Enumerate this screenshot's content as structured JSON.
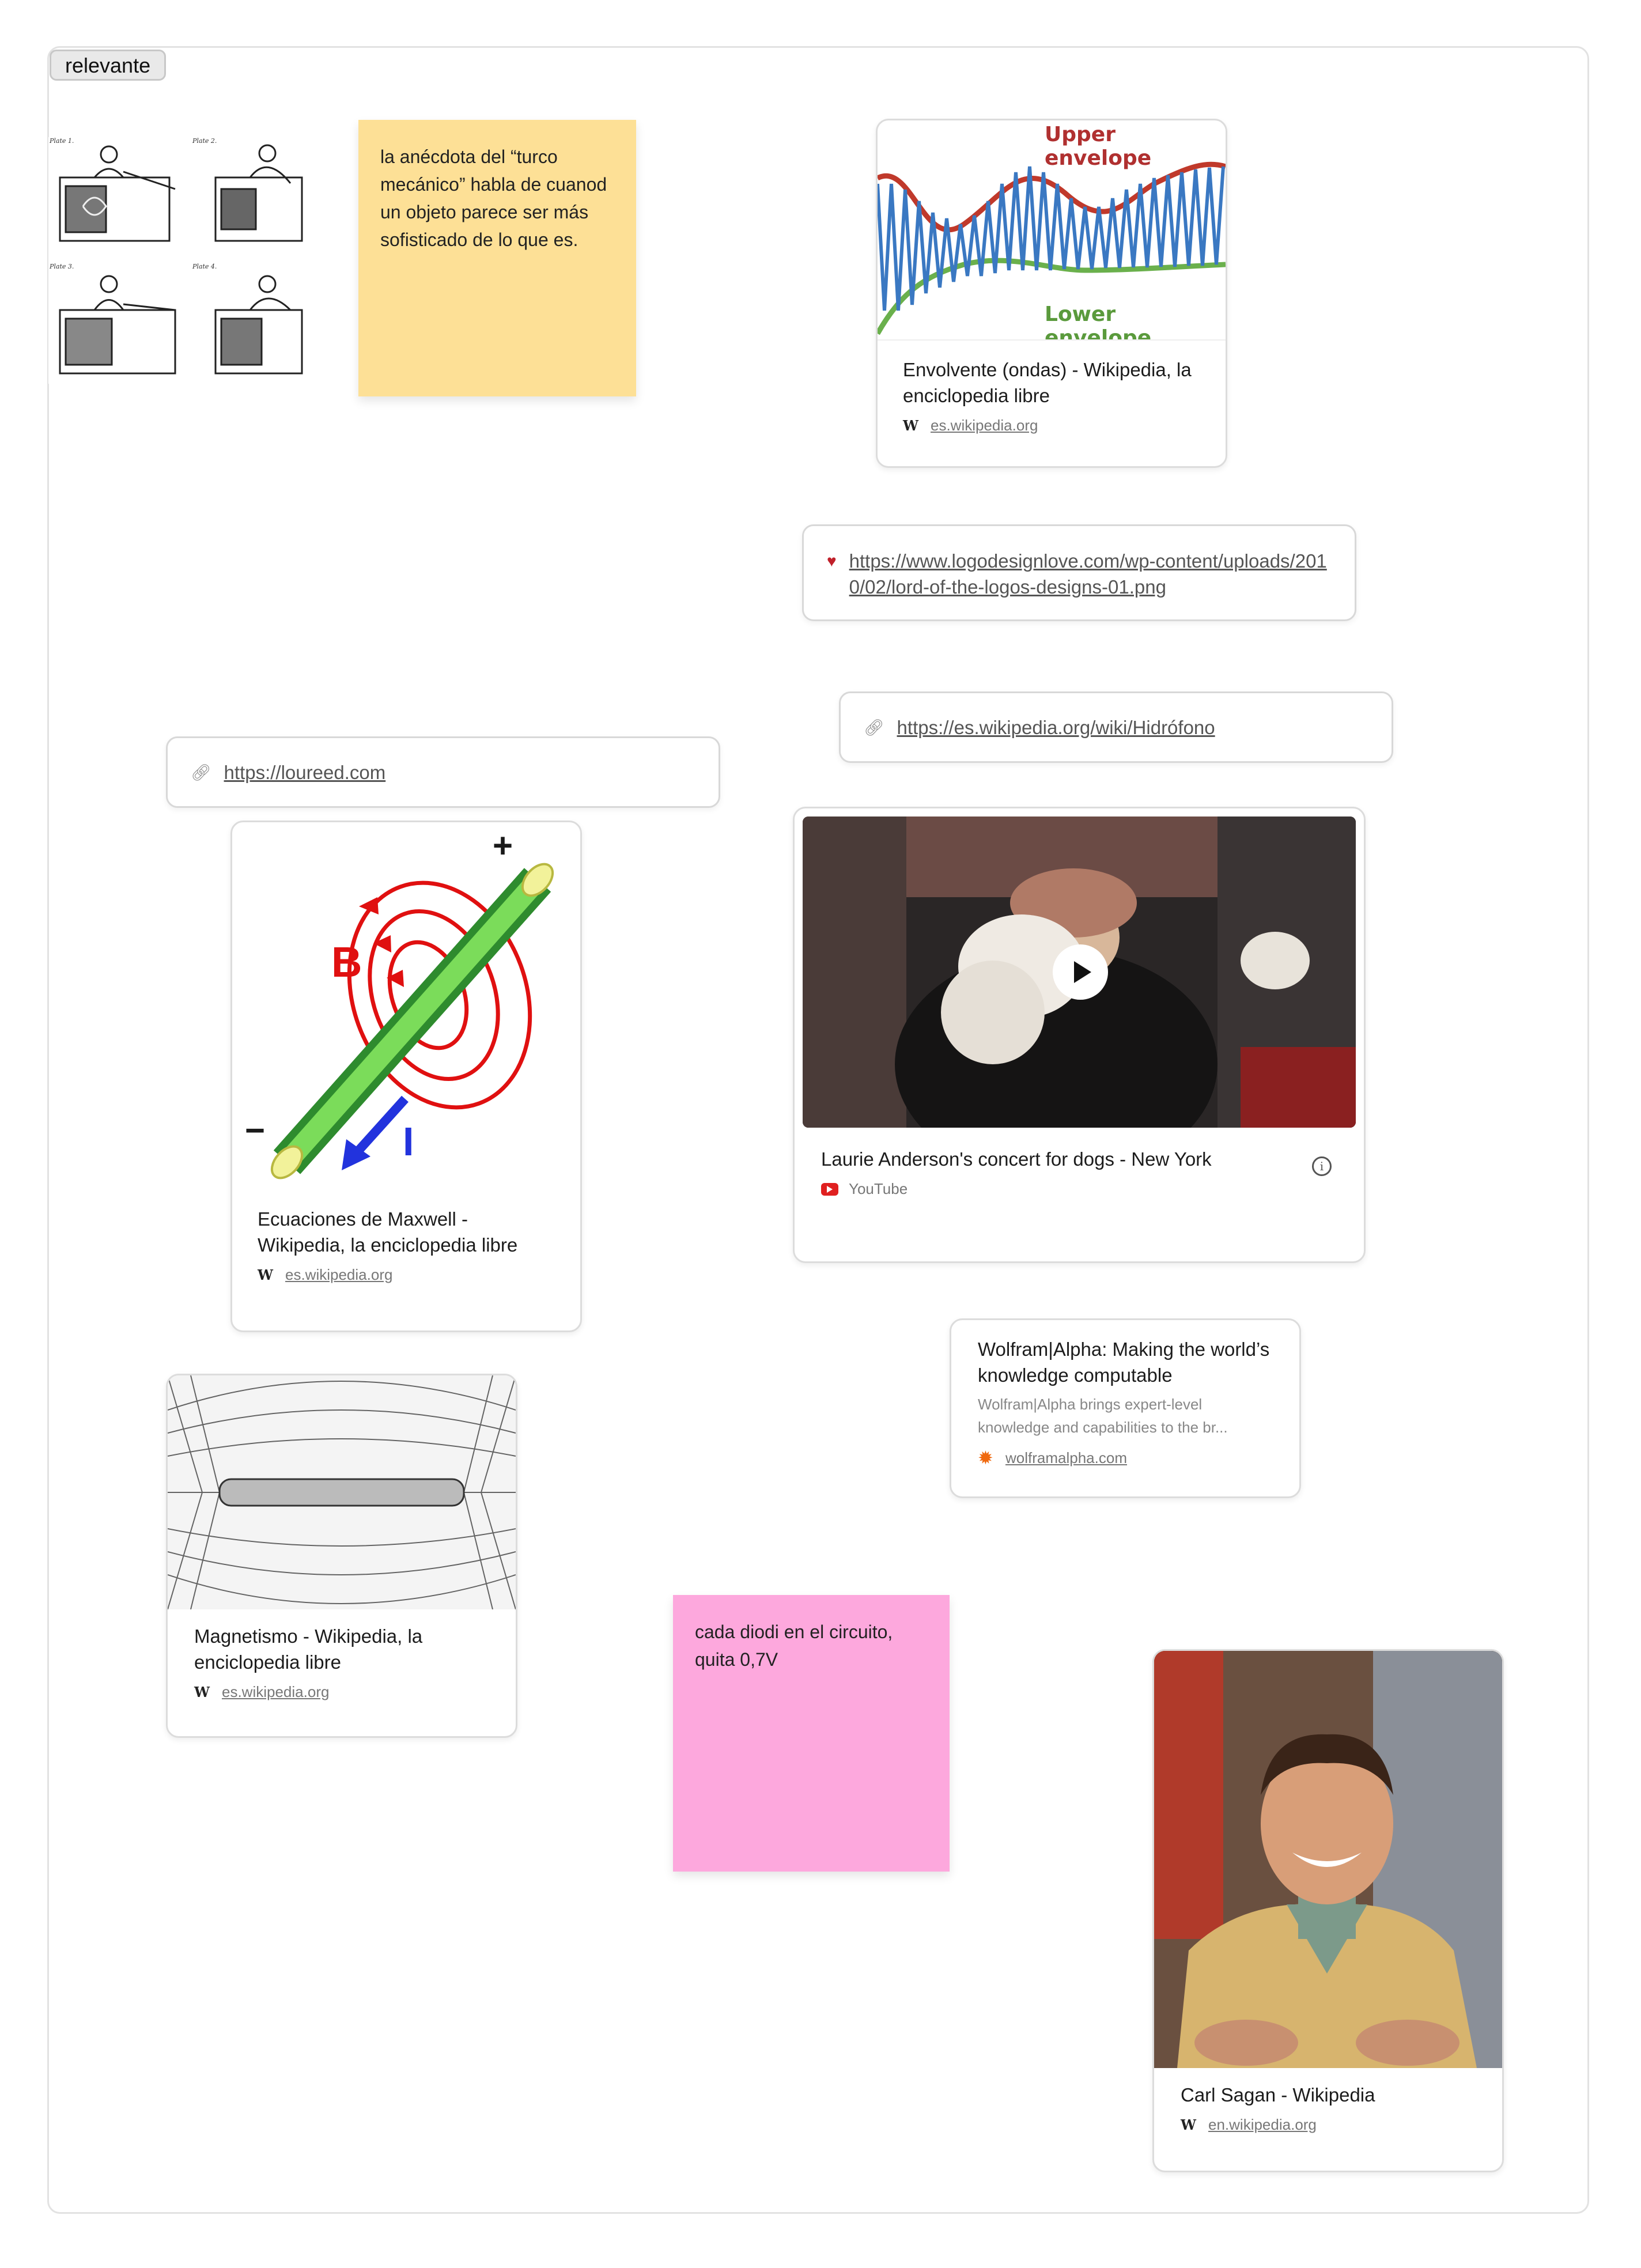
{
  "frame": {
    "label": "relevante"
  },
  "notes": {
    "turco": {
      "text": "la anécdota del “turco mecánico” habla de cuanod un objeto parece ser más sofisticado de lo que es.",
      "color": "#fde096"
    },
    "diodo": {
      "text": "cada diodi en el circuito, quita 0,7V",
      "color": "#fda8dd"
    }
  },
  "cards": {
    "envolvente": {
      "title": "Envolvente (ondas) - Wikipedia, la enciclopedia libre",
      "source": "es.wikipedia.org",
      "image_labels": {
        "upper": "Upper envelope",
        "lower": "Lower envelope"
      }
    },
    "maxwell": {
      "title": "Ecuaciones de Maxwell - Wikipedia, la enciclopedia libre",
      "source": "es.wikipedia.org",
      "image_labels": {
        "plus": "+",
        "minus": "−",
        "b": "B",
        "i": "I"
      }
    },
    "video": {
      "title": "Laurie Anderson's concert for dogs - New York",
      "source": "YouTube"
    },
    "wolfram": {
      "title": "Wolfram|Alpha: Making the world’s knowledge computable",
      "description": "Wolfram|Alpha brings expert-level knowledge and capabilities to the br...",
      "source": "wolframalpha.com"
    },
    "magnetismo": {
      "title": "Magnetismo - Wikipedia, la enciclopedia libre",
      "source": "es.wikipedia.org"
    },
    "sagan": {
      "title": "Carl Sagan - Wikipedia",
      "source": "en.wikipedia.org"
    }
  },
  "links": {
    "logodesign": {
      "url": "https://www.logodesignlove.com/wp-content/uploads/2010/02/lord-of-the-logos-designs-01.png"
    },
    "hidrofono": {
      "url": "https://es.wikipedia.org/wiki/Hidrófono"
    },
    "loureed": {
      "url": "https://loureed.com"
    }
  },
  "turk_plates": {
    "p1": "Plate 1.",
    "p2": "Plate 2.",
    "p3": "Plate 3.",
    "p4": "Plate 4."
  },
  "icons": {
    "link": "link-icon",
    "heart": "heart-icon",
    "wiki": "wikipedia-icon",
    "youtube": "youtube-icon",
    "wolfram": "wolfram-icon",
    "info": "info-icon",
    "play": "play-icon"
  },
  "colors": {
    "note_yellow": "#fde096",
    "note_pink": "#fda8dd",
    "envelope_upper": "#c0392b",
    "envelope_lower": "#6ab04c",
    "carrier": "#3a78c2",
    "field_red": "#e01010",
    "youtube_red": "#e02020"
  }
}
